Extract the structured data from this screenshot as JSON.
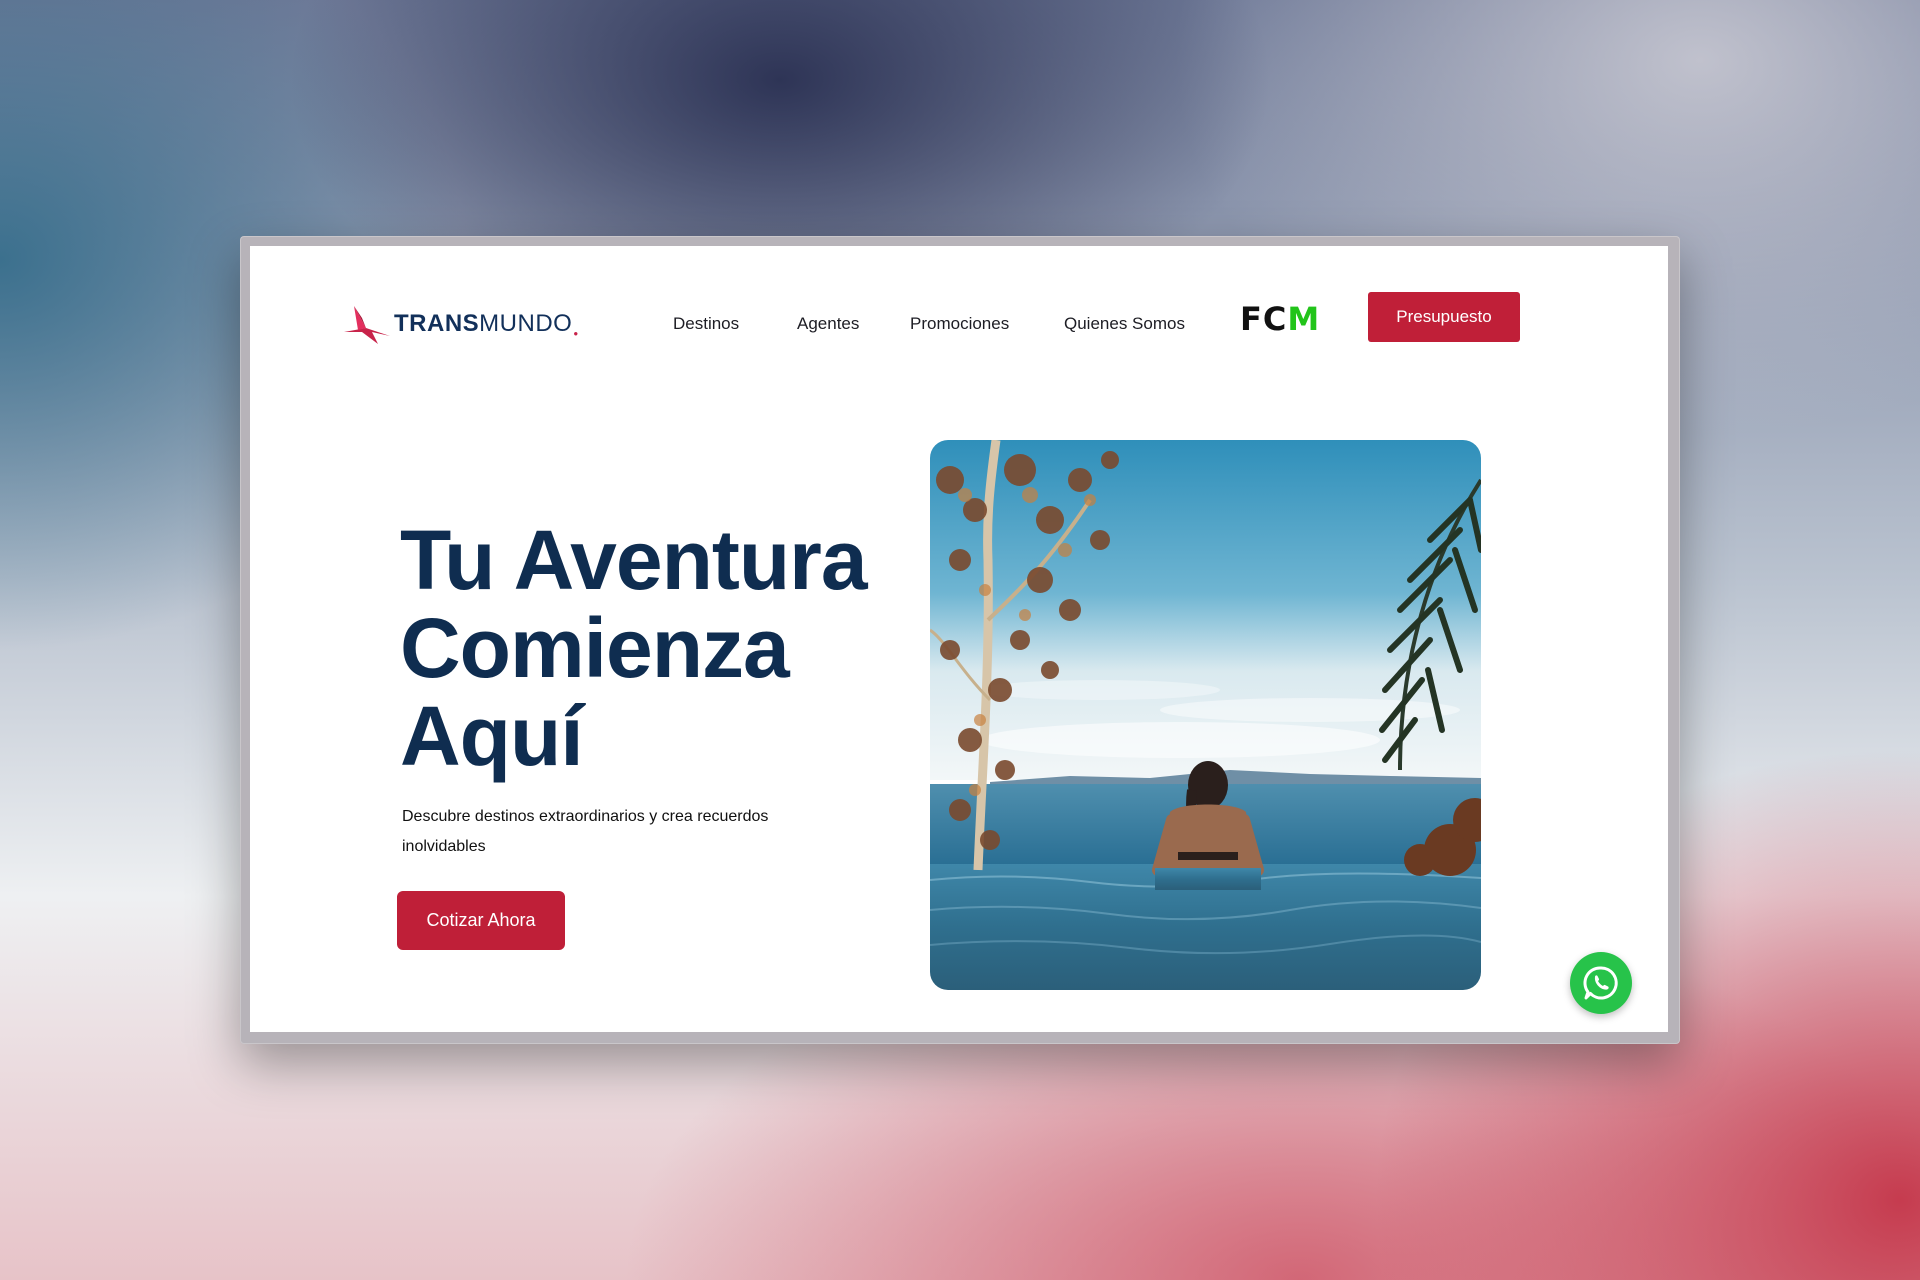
{
  "brand": {
    "logo_bold": "TRANS",
    "logo_light": "MUNDO",
    "logo_icon": "red-bird-icon",
    "accent_color": "#c01f38",
    "navy_color": "#0f2d50"
  },
  "nav": {
    "items": [
      {
        "label": "Destinos"
      },
      {
        "label": "Agentes"
      },
      {
        "label": "Promociones"
      },
      {
        "label": "Quienes Somos"
      }
    ],
    "partner_logo": {
      "fc": "FC",
      "m": "M",
      "m_color": "#22c41a"
    },
    "cta_label": "Presupuesto"
  },
  "hero": {
    "title_lines": [
      "Tu Aventura",
      "Comienza",
      "Aquí"
    ],
    "subtitle": "Descubre destinos extraordinarios y crea recuerdos inolvidables",
    "cta_label": "Cotizar Ahora",
    "image": "infinity-pool-ocean-photo"
  },
  "floating": {
    "whatsapp_icon": "whatsapp-icon",
    "whatsapp_color": "#27c34a"
  }
}
